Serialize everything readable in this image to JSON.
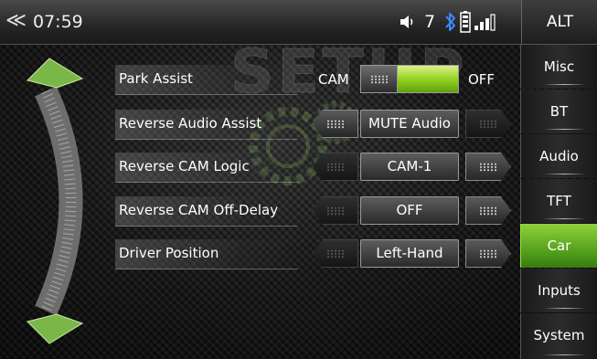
{
  "status_bar": {
    "back_icon": "double-chevron-left-icon",
    "time": "07:59",
    "volume_icon": "speaker-icon",
    "volume_level": "7",
    "bluetooth_icon": "bluetooth-icon",
    "battery_icon": "battery-icon",
    "signal_icon": "signal-bars-icon",
    "alt_label": "ALT"
  },
  "watermark": "SETUP",
  "settings": {
    "park_assist": {
      "label": "Park Assist",
      "left_option": "CAM",
      "right_option": "OFF",
      "toggle_position": "left",
      "fill_color": "#8fcf1e"
    },
    "rows": [
      {
        "label": "Reverse Audio Assist",
        "value": "MUTE Audio",
        "left_arrow_enabled": true,
        "right_arrow_enabled": false
      },
      {
        "label": "Reverse CAM Logic",
        "value": "CAM-1",
        "left_arrow_enabled": false,
        "right_arrow_enabled": true
      },
      {
        "label": "Reverse CAM Off-Delay",
        "value": "OFF",
        "left_arrow_enabled": false,
        "right_arrow_enabled": true
      },
      {
        "label": "Driver Position",
        "value": "Left-Hand",
        "left_arrow_enabled": false,
        "right_arrow_enabled": true
      }
    ]
  },
  "sidebar": {
    "active": "Car",
    "accent_color": "#5fa81e",
    "items": [
      {
        "label": "Misc"
      },
      {
        "label": "BT"
      },
      {
        "label": "Audio"
      },
      {
        "label": "TFT"
      },
      {
        "label": "Car"
      },
      {
        "label": "Inputs"
      },
      {
        "label": "System"
      }
    ]
  }
}
